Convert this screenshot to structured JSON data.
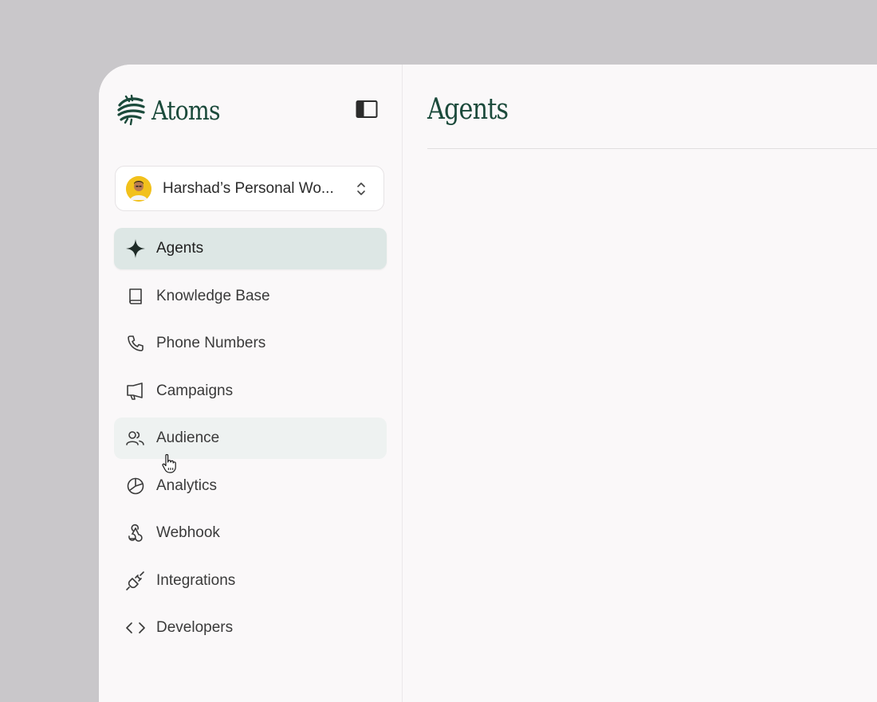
{
  "app": {
    "name": "Atoms",
    "accent_color": "#1b4a3b",
    "logo_icon": "atoms-logo-icon",
    "sidebar_toggle_icon": "sidebar-toggle-icon"
  },
  "workspace": {
    "name": "Harshad’s Personal Wo...",
    "avatar_color": "#f2c11c",
    "chevron_icon": "chevron-up-down-icon"
  },
  "nav": {
    "items": [
      {
        "label": "Agents",
        "icon": "sparkle-icon",
        "state": "active"
      },
      {
        "label": "Knowledge Base",
        "icon": "book-icon"
      },
      {
        "label": "Phone Numbers",
        "icon": "phone-icon"
      },
      {
        "label": "Campaigns",
        "icon": "megaphone-icon"
      },
      {
        "label": "Audience",
        "icon": "users-icon",
        "state": "hover"
      },
      {
        "label": "Analytics",
        "icon": "pie-chart-icon"
      },
      {
        "label": "Webhook",
        "icon": "webhook-icon"
      },
      {
        "label": "Integrations",
        "icon": "plug-icon"
      },
      {
        "label": "Developers",
        "icon": "code-icon"
      }
    ]
  },
  "main": {
    "title": "Agents"
  },
  "colors": {
    "background": "#c9c7ca",
    "panel": "#faf8f9",
    "active_item": "#dde7e5",
    "hover_item": "#eef2f1"
  }
}
